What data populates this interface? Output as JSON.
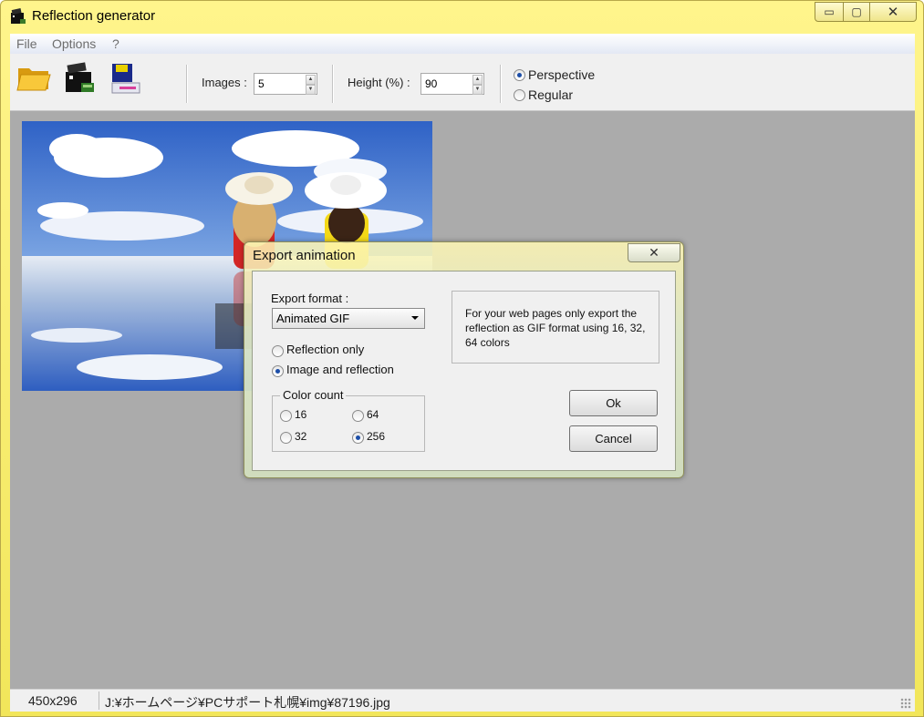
{
  "window": {
    "title": "Reflection generator",
    "buttons": {
      "minimize": "▭",
      "maximize": "▢",
      "close": "✕"
    }
  },
  "menu": {
    "items": [
      "File",
      "Options",
      "?"
    ]
  },
  "toolbar": {
    "icons": [
      "open-folder-icon",
      "film-icon",
      "save-disk-icon"
    ],
    "images_label": "Images :",
    "images_value": "5",
    "height_label": "Height (%) :",
    "height_value": "90",
    "mode_options": [
      "Perspective",
      "Regular"
    ],
    "mode_selected": "Perspective"
  },
  "status": {
    "size": "450x296",
    "path": "J:¥ホームページ¥PCサポート札幌¥img¥87196.jpg"
  },
  "dialog": {
    "title": "Export animation",
    "close": "✕",
    "format_label": "Export format :",
    "format_value": "Animated GIF",
    "content_options": [
      "Reflection only",
      "Image and reflection"
    ],
    "content_selected": "Image and reflection",
    "info": "For your web pages only export the reflection as GIF format using 16, 32, 64 colors",
    "color_count_title": "Color count",
    "color_options": [
      "16",
      "64",
      "32",
      "256"
    ],
    "color_selected": "256",
    "ok_label": "Ok",
    "cancel_label": "Cancel"
  },
  "colors": {
    "title_bar": "#f6ec74",
    "workspace": "#ababab",
    "radio_dot": "#1c4ea8"
  }
}
